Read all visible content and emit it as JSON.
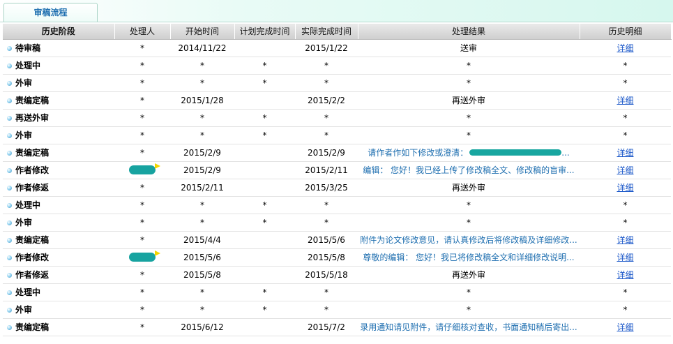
{
  "tab": {
    "label": "审稿流程"
  },
  "columns": {
    "stage": "历史阶段",
    "handler": "处理人",
    "start": "开始时间",
    "planned": "计划完成时间",
    "actual": "实际完成时间",
    "result": "处理结果",
    "history": "历史明细"
  },
  "rows": [
    {
      "stage": "待审稿",
      "handler": "*",
      "start": "2014/11/22",
      "planned": "",
      "actual": "2015/1/22",
      "result": "送审",
      "result_style": "plain",
      "history": "详细",
      "history_link": true
    },
    {
      "stage": "处理中",
      "handler": "*",
      "start": "*",
      "planned": "*",
      "actual": "*",
      "result": "*",
      "result_style": "plain",
      "history": "*",
      "history_link": false
    },
    {
      "stage": "外审",
      "handler": "*",
      "start": "*",
      "planned": "*",
      "actual": "*",
      "result": "*",
      "result_style": "plain",
      "history": "*",
      "history_link": false
    },
    {
      "stage": "责编定稿",
      "handler": "*",
      "start": "2015/1/28",
      "planned": "",
      "actual": "2015/2/2",
      "result": "再送外审",
      "result_style": "plain",
      "history": "详细",
      "history_link": true
    },
    {
      "stage": "再送外审",
      "handler": "*",
      "start": "*",
      "planned": "*",
      "actual": "*",
      "result": "*",
      "result_style": "plain",
      "history": "*",
      "history_link": false
    },
    {
      "stage": "外审",
      "handler": "*",
      "start": "*",
      "planned": "*",
      "actual": "*",
      "result": "*",
      "result_style": "plain",
      "history": "*",
      "history_link": false
    },
    {
      "stage": "责编定稿",
      "handler": "*",
      "start": "2015/2/9",
      "planned": "",
      "actual": "2015/2/9",
      "result": "请作者作如下修改或澄清：",
      "result_suffix": "...",
      "redacted_result": true,
      "result_style": "link",
      "history": "详细",
      "history_link": true
    },
    {
      "stage": "作者修改",
      "handler": "",
      "redacted_handler": true,
      "start": "2015/2/9",
      "planned": "",
      "actual": "2015/2/11",
      "result": "编辑： 您好！我已经上传了修改稿全文、修改稿的盲审...",
      "result_style": "link",
      "history": "详细",
      "history_link": true
    },
    {
      "stage": "作者修返",
      "handler": "*",
      "start": "2015/2/11",
      "planned": "",
      "actual": "2015/3/25",
      "result": "再送外审",
      "result_style": "plain",
      "history": "详细",
      "history_link": true
    },
    {
      "stage": "处理中",
      "handler": "*",
      "start": "*",
      "planned": "*",
      "actual": "*",
      "result": "*",
      "result_style": "plain",
      "history": "*",
      "history_link": false
    },
    {
      "stage": "外审",
      "handler": "*",
      "start": "*",
      "planned": "*",
      "actual": "*",
      "result": "*",
      "result_style": "plain",
      "history": "*",
      "history_link": false
    },
    {
      "stage": "责编定稿",
      "handler": "*",
      "start": "2015/4/4",
      "planned": "",
      "actual": "2015/5/6",
      "result": "附件为论文修改意见，请认真修改后将修改稿及详细修改...",
      "result_style": "link",
      "history": "详细",
      "history_link": true
    },
    {
      "stage": "作者修改",
      "handler": "",
      "redacted_handler": true,
      "start": "2015/5/6",
      "planned": "",
      "actual": "2015/5/8",
      "result": "尊敬的编辑： 您好！我已将修改稿全文和详细修改说明...",
      "result_style": "link",
      "history": "详细",
      "history_link": true
    },
    {
      "stage": "作者修返",
      "handler": "*",
      "start": "2015/5/8",
      "planned": "",
      "actual": "2015/5/18",
      "result": "再送外审",
      "result_style": "plain",
      "history": "详细",
      "history_link": true
    },
    {
      "stage": "处理中",
      "handler": "*",
      "start": "*",
      "planned": "*",
      "actual": "*",
      "result": "*",
      "result_style": "plain",
      "history": "*",
      "history_link": false
    },
    {
      "stage": "外审",
      "handler": "*",
      "start": "*",
      "planned": "*",
      "actual": "*",
      "result": "*",
      "result_style": "plain",
      "history": "*",
      "history_link": false
    },
    {
      "stage": "责编定稿",
      "handler": "*",
      "start": "2015/6/12",
      "planned": "",
      "actual": "2015/7/2",
      "result": "录用通知请见附件，请仔细核对查收，书面通知稍后寄出...",
      "result_style": "link",
      "history": "详细",
      "history_link": true
    }
  ]
}
